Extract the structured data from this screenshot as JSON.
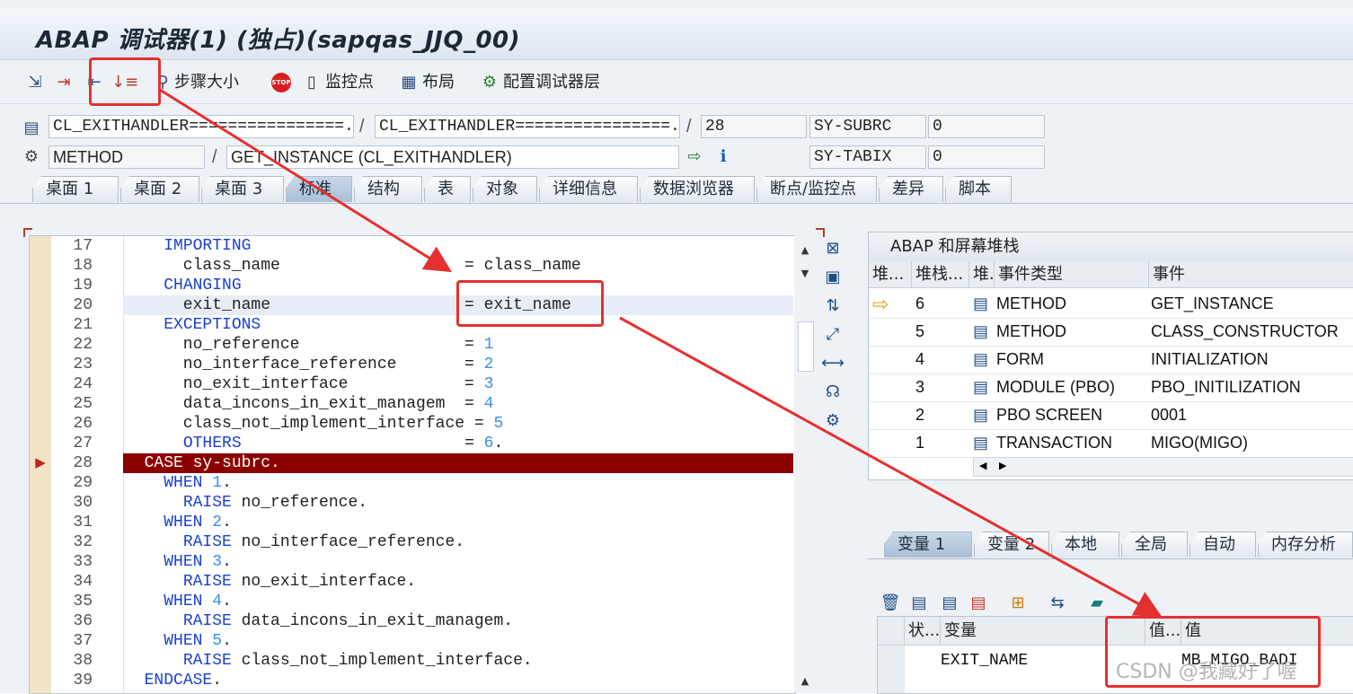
{
  "window": {
    "title": "ABAP 调试器(1)  (独占)(sapqas_JJQ_00)"
  },
  "toolbar": {
    "icons": [
      "step-into-icon",
      "execute-icon",
      "return-icon",
      "continue-icon"
    ],
    "step_size": "步骤大小",
    "watchpoint": "监控点",
    "layout": "布局",
    "configure": "配置调试器层",
    "stop_text": "STOP"
  },
  "info": {
    "program1": "CL_EXITHANDLER================...",
    "program2": "CL_EXITHANDLER================...",
    "line": "28",
    "type": "METHOD",
    "event": "GET_INSTANCE (CL_EXITHANDLER)",
    "sy1_name": "SY-SUBRC",
    "sy1_value": "0",
    "sy2_name": "SY-TABIX",
    "sy2_value": "0",
    "slash": "/"
  },
  "tabs": [
    "桌面 1",
    "桌面 2",
    "桌面 3",
    "标准",
    "结构",
    "表",
    "对象",
    "详细信息",
    "数据浏览器",
    "断点/监控点",
    "差异",
    "脚本"
  ],
  "active_tab": "标准",
  "code": [
    {
      "n": "17",
      "t": "    IMPORTING"
    },
    {
      "n": "18",
      "t": "      class_name                   = class_name"
    },
    {
      "n": "19",
      "t": "    CHANGING"
    },
    {
      "n": "20",
      "t": "      exit_name                    = exit_name"
    },
    {
      "n": "21",
      "t": "    EXCEPTIONS"
    },
    {
      "n": "22",
      "t": "      no_reference                 = 1"
    },
    {
      "n": "23",
      "t": "      no_interface_reference       = 2"
    },
    {
      "n": "24",
      "t": "      no_exit_interface            = 3"
    },
    {
      "n": "25",
      "t": "      data_incons_in_exit_managem  = 4"
    },
    {
      "n": "26",
      "t": "      class_not_implement_interface = 5"
    },
    {
      "n": "27",
      "t": "      OTHERS                       = 6."
    },
    {
      "n": "28",
      "t": "  CASE sy-subrc."
    },
    {
      "n": "29",
      "t": "    WHEN 1."
    },
    {
      "n": "30",
      "t": "      RAISE no_reference."
    },
    {
      "n": "31",
      "t": "    WHEN 2."
    },
    {
      "n": "32",
      "t": "      RAISE no_interface_reference."
    },
    {
      "n": "33",
      "t": "    WHEN 3."
    },
    {
      "n": "34",
      "t": "      RAISE no_exit_interface."
    },
    {
      "n": "35",
      "t": "    WHEN 4."
    },
    {
      "n": "36",
      "t": "      RAISE data_incons_in_exit_managem."
    },
    {
      "n": "37",
      "t": "    WHEN 5."
    },
    {
      "n": "38",
      "t": "      RAISE class_not_implement_interface."
    },
    {
      "n": "39",
      "t": "  ENDCASE."
    }
  ],
  "stack": {
    "title": "ABAP 和屏幕堆栈",
    "headers": [
      "堆...",
      "堆栈...",
      "堆...",
      "事件类型",
      "事件"
    ],
    "rows": [
      {
        "level": "6",
        "type": "METHOD",
        "event": "GET_INSTANCE",
        "current": true
      },
      {
        "level": "5",
        "type": "METHOD",
        "event": "CLASS_CONSTRUCTOR"
      },
      {
        "level": "4",
        "type": "FORM",
        "event": "INITIALIZATION"
      },
      {
        "level": "3",
        "type": "MODULE (PBO)",
        "event": "PBO_INITILIZATION"
      },
      {
        "level": "2",
        "type": "PBO SCREEN",
        "event": "0001"
      },
      {
        "level": "1",
        "type": "TRANSACTION",
        "event": "MIGO(MIGO)"
      }
    ]
  },
  "var_tabs": [
    "变量 1",
    "变量 2",
    "本地",
    "全局",
    "自动",
    "内存分析"
  ],
  "active_var_tab": "变量 1",
  "var_grid": {
    "headers": [
      "状...",
      "变量",
      "值...",
      "值"
    ],
    "rows": [
      {
        "name": "EXIT_NAME",
        "value": "MB_MIGO_BADI"
      }
    ]
  },
  "watermark": "CSDN @我藏好了喔",
  "colors": {
    "current_line": "#8a0000",
    "keyword": "#1a3fd1",
    "annotation": "#e53030"
  }
}
